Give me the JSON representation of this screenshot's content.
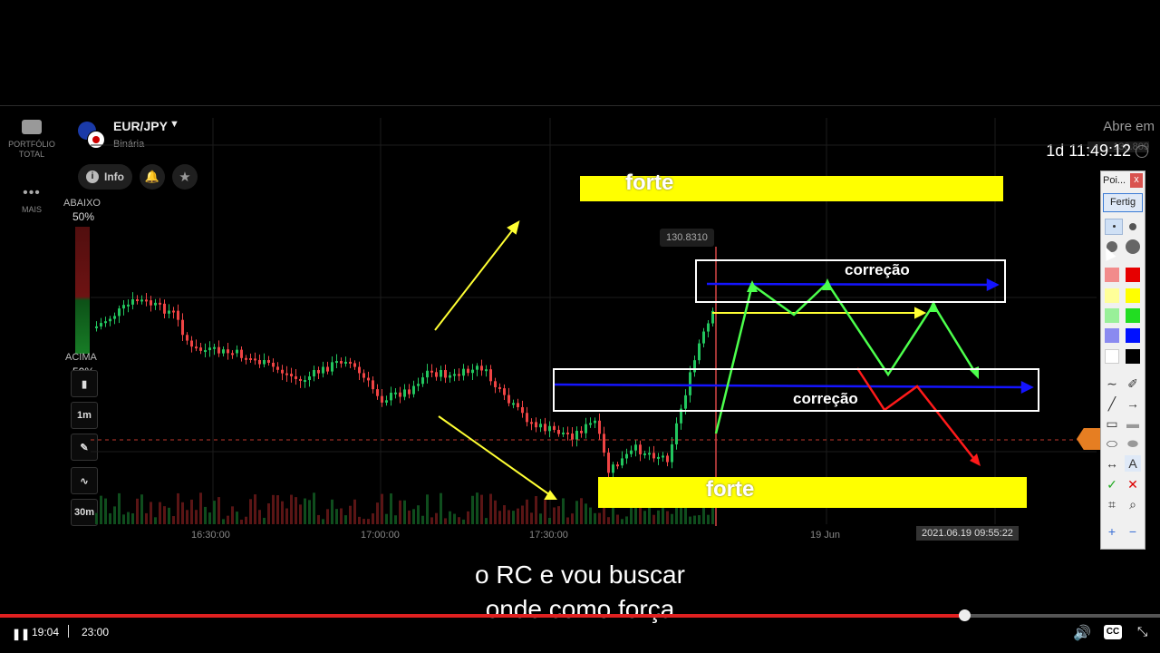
{
  "left_nav": {
    "portfolio_label": "PORTFÓLIO\nTOTAL",
    "more_label": "MAIS"
  },
  "asset": {
    "pair": "EUR/JPY",
    "type": "Binária",
    "info_label": "Info"
  },
  "expiry": {
    "label": "Abre em",
    "countdown": "1d 11:49:12",
    "price_tag_behind": "130.809"
  },
  "sentiment": {
    "down_label": "ABAIXO",
    "down_pct": "50%",
    "up_label": "ACIMA",
    "up_pct": "50%"
  },
  "tools": {
    "timeframe": "1m",
    "candle_size": "30m"
  },
  "chart": {
    "price_label": "130.8310",
    "x_ticks": [
      "16:30:00",
      "17:00:00",
      "17:30:00",
      "19 Jun"
    ],
    "cursor_time": "2021.06.19 09:55:22",
    "annotations": {
      "top_band": "forte",
      "bottom_band": "forte",
      "upper_box": "correção",
      "lower_box": "correção"
    },
    "colors": {
      "bull": "#22c55e",
      "bear": "#ef4444",
      "band": "#ffff00",
      "trend_green": "#4cff4c",
      "trend_red": "#ff1a1a",
      "level_blue": "#1414ff"
    }
  },
  "draw_panel": {
    "title": "Poi...",
    "close": "x",
    "button": "Fertig"
  },
  "subtitles": {
    "line1": "o RC e vou buscar",
    "line2": "onde como força"
  },
  "player": {
    "current_time": "19:04",
    "duration": "23:00",
    "progress": 0.831
  }
}
